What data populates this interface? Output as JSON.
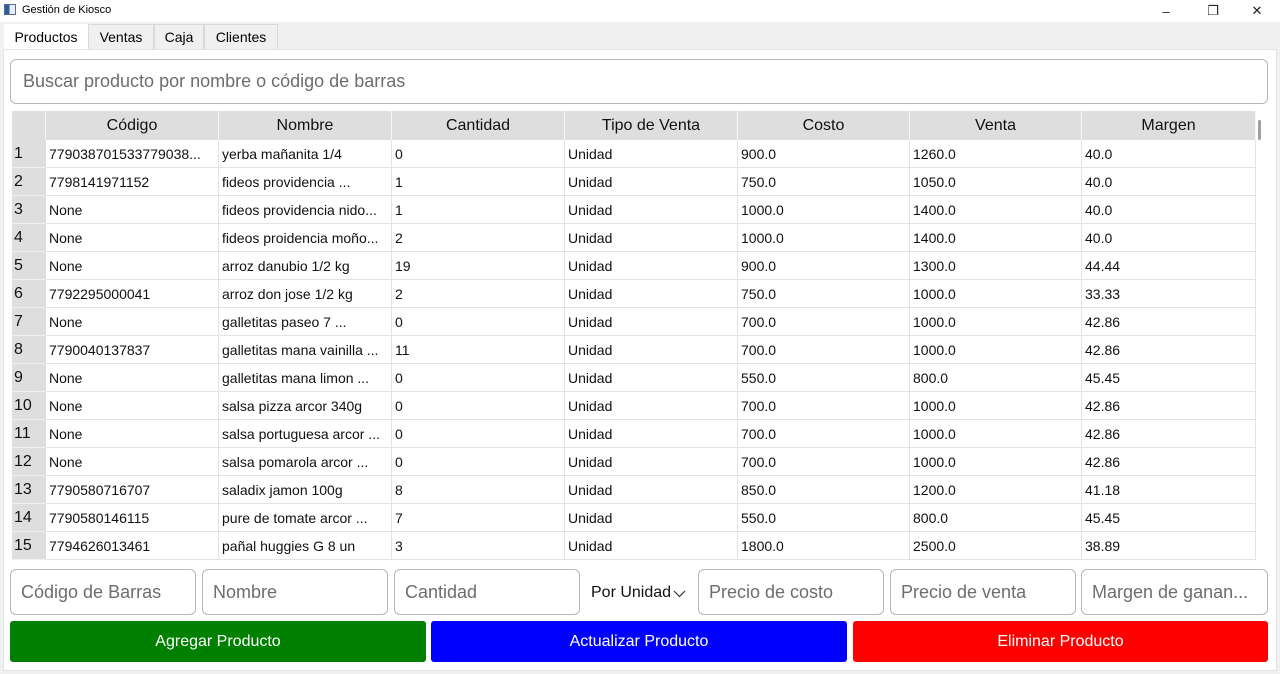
{
  "window": {
    "title": "Gestión de Kiosco",
    "minimize_glyph": "–",
    "maximize_glyph": "❐",
    "close_glyph": "✕"
  },
  "tabs": [
    {
      "label": "Productos",
      "active": true
    },
    {
      "label": "Ventas",
      "active": false
    },
    {
      "label": "Caja",
      "active": false
    },
    {
      "label": "Clientes",
      "active": false
    }
  ],
  "search": {
    "placeholder": "Buscar producto por nombre o código de barras"
  },
  "table": {
    "headers": [
      "Código",
      "Nombre",
      "Cantidad",
      "Tipo de Venta",
      "Costo",
      "Venta",
      "Margen"
    ],
    "rows": [
      {
        "n": "1",
        "cells": [
          "779038701533779038...",
          "yerba mañanita 1/4",
          "0",
          "Unidad",
          "900.0",
          "1260.0",
          "40.0"
        ]
      },
      {
        "n": "2",
        "cells": [
          "7798141971152",
          "fideos providencia ...",
          "1",
          "Unidad",
          "750.0",
          "1050.0",
          "40.0"
        ]
      },
      {
        "n": "3",
        "cells": [
          "None",
          "fideos providencia nido...",
          "1",
          "Unidad",
          "1000.0",
          "1400.0",
          "40.0"
        ]
      },
      {
        "n": "4",
        "cells": [
          "None",
          "fideos proidencia moño...",
          "2",
          "Unidad",
          "1000.0",
          "1400.0",
          "40.0"
        ]
      },
      {
        "n": "5",
        "cells": [
          "None",
          "arroz danubio 1/2 kg",
          "19",
          "Unidad",
          "900.0",
          "1300.0",
          "44.44"
        ]
      },
      {
        "n": "6",
        "cells": [
          "7792295000041",
          "arroz don jose 1/2 kg",
          "2",
          "Unidad",
          "750.0",
          "1000.0",
          "33.33"
        ]
      },
      {
        "n": "7",
        "cells": [
          "None",
          "galletitas paseo 7 ...",
          "0",
          "Unidad",
          "700.0",
          "1000.0",
          "42.86"
        ]
      },
      {
        "n": "8",
        "cells": [
          "7790040137837",
          "galletitas mana vainilla ...",
          "11",
          "Unidad",
          "700.0",
          "1000.0",
          "42.86"
        ]
      },
      {
        "n": "9",
        "cells": [
          "None",
          "galletitas mana limon ...",
          "0",
          "Unidad",
          "550.0",
          "800.0",
          "45.45"
        ]
      },
      {
        "n": "10",
        "cells": [
          "None",
          "salsa pizza arcor 340g",
          "0",
          "Unidad",
          "700.0",
          "1000.0",
          "42.86"
        ]
      },
      {
        "n": "11",
        "cells": [
          "None",
          "salsa portuguesa arcor ...",
          "0",
          "Unidad",
          "700.0",
          "1000.0",
          "42.86"
        ]
      },
      {
        "n": "12",
        "cells": [
          "None",
          "salsa pomarola arcor ...",
          "0",
          "Unidad",
          "700.0",
          "1000.0",
          "42.86"
        ]
      },
      {
        "n": "13",
        "cells": [
          "7790580716707",
          "saladix jamon 100g",
          "8",
          "Unidad",
          "850.0",
          "1200.0",
          "41.18"
        ]
      },
      {
        "n": "14",
        "cells": [
          "7790580146115",
          "pure de tomate arcor ...",
          "7",
          "Unidad",
          "550.0",
          "800.0",
          "45.45"
        ]
      },
      {
        "n": "15",
        "cells": [
          "7794626013461",
          "pañal huggies G 8 un",
          "3",
          "Unidad",
          "1800.0",
          "2500.0",
          "38.89"
        ]
      }
    ]
  },
  "form": {
    "barcode_placeholder": "Código de Barras",
    "name_placeholder": "Nombre",
    "quantity_placeholder": "Cantidad",
    "sale_type_value": "Por Unidad",
    "cost_placeholder": "Precio de costo",
    "price_placeholder": "Precio de venta",
    "margin_placeholder": "Margen de ganan..."
  },
  "actions": {
    "add_label": "Agregar Producto",
    "update_label": "Actualizar Producto",
    "delete_label": "Eliminar Producto"
  },
  "colors": {
    "add": "#008000",
    "update": "#0000ff",
    "delete": "#ff0000"
  }
}
